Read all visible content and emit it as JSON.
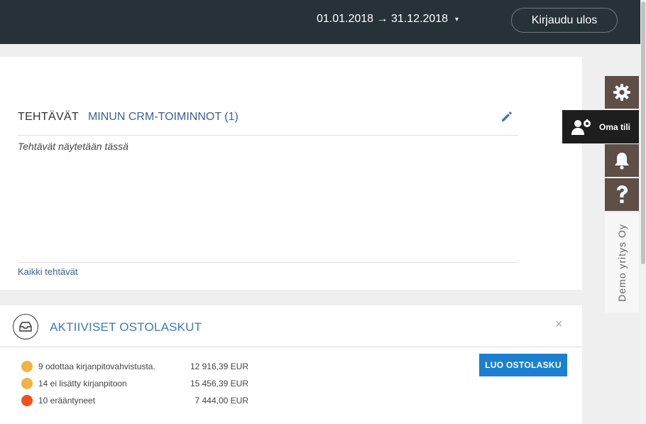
{
  "header": {
    "date_range": "01.01.2018 → 31.12.2018",
    "date_caret": "▾",
    "logout_label": "Kirjaudu ulos"
  },
  "tasks": {
    "title": "TEHTÄVÄT",
    "tab_label": "MINUN CRM-TOIMINNOT (1)",
    "empty_text": "Tehtävät näytetään tässä",
    "all_link": "Kaikki tehtävät"
  },
  "invoices": {
    "title": "AKTIIVISET OSTOLASKUT",
    "close_label": "×",
    "create_label": "LUO OSTOLASKU",
    "rows": [
      {
        "label": "9 odottaa kirjanpitovahvistusta.",
        "amount": "12 916,39 EUR",
        "color": "#f0b443"
      },
      {
        "label": "14 ei lisätty kirjanpitoon",
        "amount": "15 456,39 EUR",
        "color": "#f0b443"
      },
      {
        "label": "10 erääntyneet",
        "amount": "7 444,00 EUR",
        "color": "#f4511e"
      }
    ]
  },
  "side_panel": {
    "account_label": "Oma tili",
    "company_name": "Demo yritys Oy",
    "icons": [
      "gear-icon",
      "users-cog-icon",
      "bell-icon",
      "question-icon"
    ]
  },
  "colors": {
    "header_bg": "#263238",
    "accent_blue": "#3f7bb6",
    "button_blue": "#1c7fd0",
    "side_tab_bg": "#5d4f48"
  }
}
